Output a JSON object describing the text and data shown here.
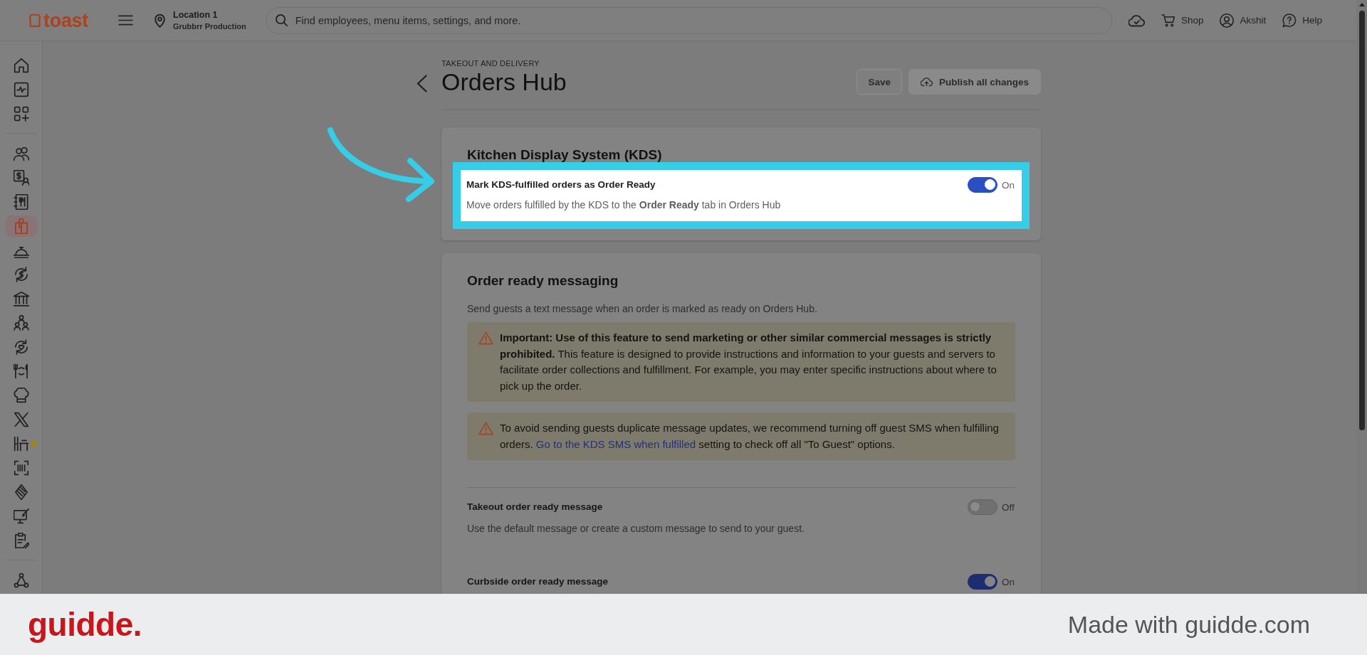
{
  "top_bar": {
    "logo": "toast",
    "location": {
      "name": "Location 1",
      "subtitle": "Grubbrr Production"
    },
    "search": {
      "placeholder": "Find employees, menu items, settings, and more."
    },
    "actions": [
      {
        "label": "Shop"
      },
      {
        "label": "Akshit"
      },
      {
        "label": "Help"
      }
    ]
  },
  "sidebar": {
    "groups": [
      {
        "items": [
          {
            "selected": false,
            "dot": false
          },
          {
            "selected": false,
            "dot": false
          },
          {
            "selected": false,
            "dot": false
          }
        ]
      },
      {
        "items": [
          {
            "selected": false,
            "dot": false
          },
          {
            "selected": false,
            "dot": false
          },
          {
            "selected": false,
            "dot": false
          },
          {
            "selected": true,
            "dot": false
          },
          {
            "selected": false,
            "dot": false
          },
          {
            "selected": false,
            "dot": false
          },
          {
            "selected": false,
            "dot": false
          },
          {
            "selected": false,
            "dot": false
          },
          {
            "selected": false,
            "dot": false
          },
          {
            "selected": false,
            "dot": false
          },
          {
            "selected": false,
            "dot": false
          },
          {
            "selected": false,
            "dot": false
          },
          {
            "selected": false,
            "dot": true
          },
          {
            "selected": false,
            "dot": false
          },
          {
            "selected": false,
            "dot": false
          },
          {
            "selected": false,
            "dot": false
          },
          {
            "selected": false,
            "dot": false
          }
        ]
      },
      {
        "items": [
          {
            "selected": false,
            "dot": false
          }
        ]
      }
    ]
  },
  "header": {
    "section": "TAKEOUT AND DELIVERY",
    "title": "Orders Hub",
    "buttons": [
      {
        "label": "Save",
        "kind": "secondary",
        "disabled": true
      },
      {
        "label": "Publish all changes",
        "kind": "primary",
        "disabled": true
      }
    ]
  },
  "cards": [
    {
      "title": "Kitchen Display System (KDS)",
      "settings": [
        {
          "label": "Mark KDS-fulfilled orders as **Order Ready**",
          "description": "Move orders fulfilled by the KDS to the **Order Ready** tab in Orders Hub",
          "on": true,
          "state_label": "On",
          "highlighted": true
        }
      ]
    },
    {
      "title": "Order ready messaging",
      "description": "Send guests a text message when an order is marked as ready on Orders Hub.",
      "notices": [
        {
          "text": "**Important: Use of this feature to send marketing or other similar commercial messages is strictly prohibited.** This feature is designed to provide instructions and information to your guests and servers to facilitate order collections and fulfillment. For example, you may enter specific instructions about where to pick up the order."
        },
        {
          "text": "To avoid sending guests duplicate message updates, we recommend turning off guest SMS when fulfilling orders.",
          "link": "Go to the KDS SMS when fulfilled",
          "text_after": "setting to check off all \"To Guest\" options."
        }
      ],
      "settings": [
        {
          "label": "Takeout order ready message",
          "description": "Use the default message or create a custom message to send to your guest.",
          "on": false,
          "state_label": "Off",
          "highlighted": false
        },
        {
          "label": "Curbside order ready message",
          "on": true,
          "state_label": "On",
          "highlighted": false
        }
      ]
    }
  ],
  "footer": {
    "logo": "guidde.",
    "credit": "Made with guidde.com"
  }
}
